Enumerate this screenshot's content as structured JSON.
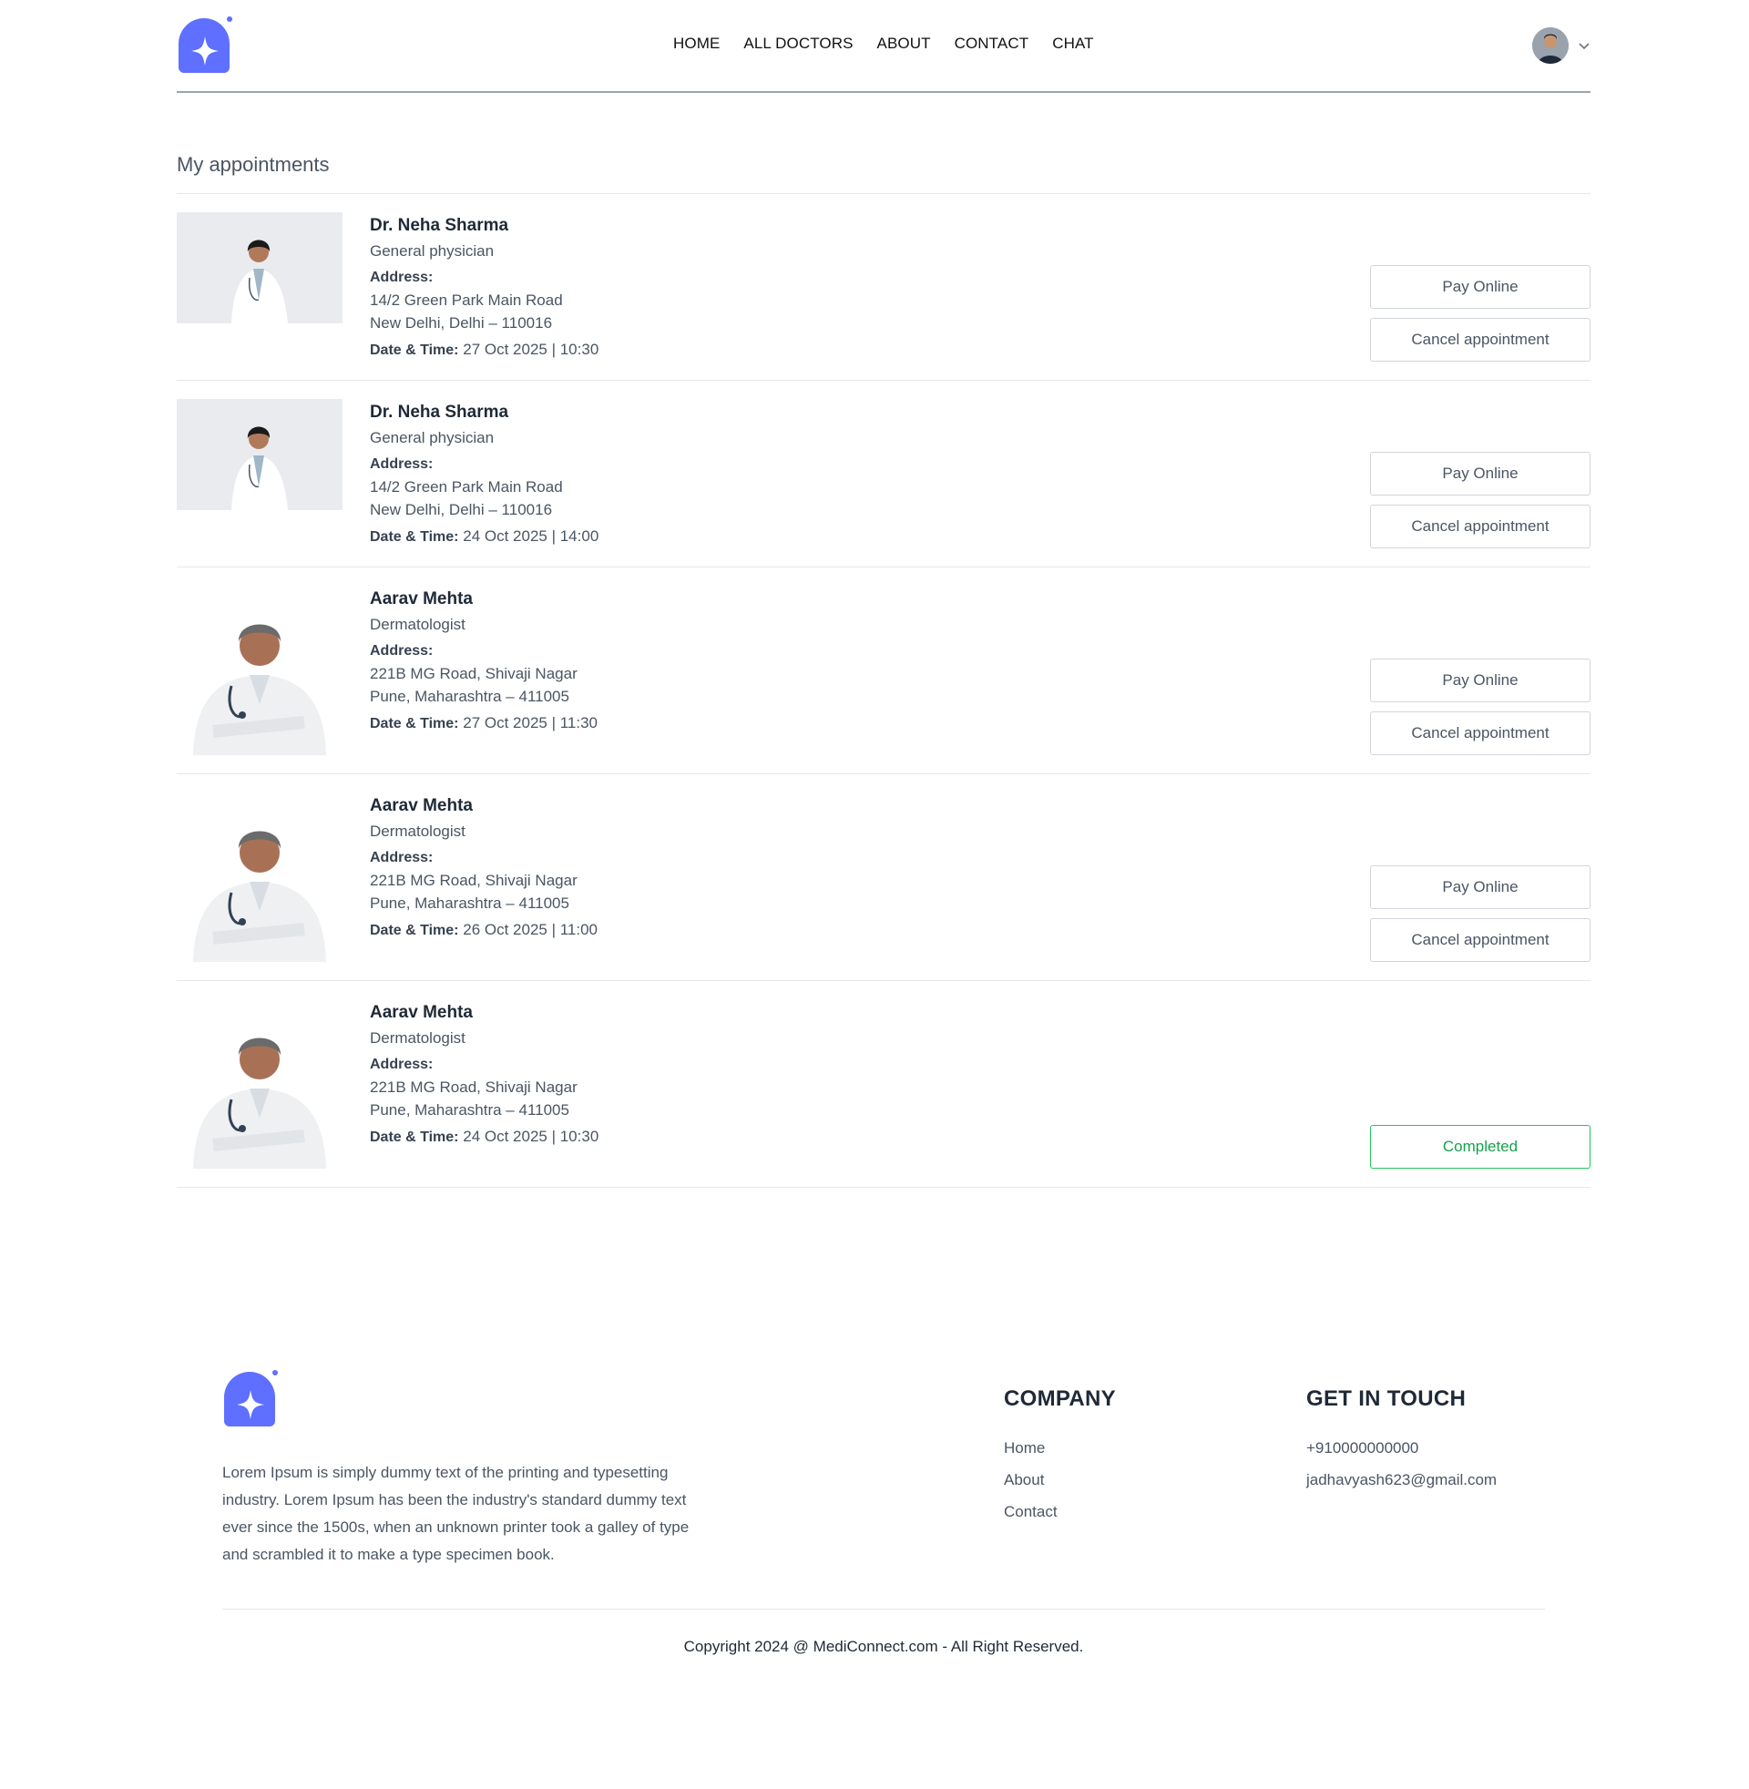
{
  "brand": {
    "accent": "#5f6fff"
  },
  "nav": {
    "items": [
      "HOME",
      "ALL DOCTORS",
      "ABOUT",
      "CONTACT",
      "CHAT"
    ]
  },
  "page": {
    "title": "My appointments"
  },
  "appointments": [
    {
      "name": "Dr. Neha Sharma",
      "speciality": "General physician",
      "address_label": "Address:",
      "address_line1": "14/2 Green Park Main Road",
      "address_line2": "New Delhi, Delhi – 110016",
      "datetime_label": "Date & Time:",
      "datetime": "27 Oct 2025 | 10:30",
      "pay_label": "Pay Online",
      "cancel_label": "Cancel appointment",
      "photo": "female-doctor"
    },
    {
      "name": "Dr. Neha Sharma",
      "speciality": "General physician",
      "address_label": "Address:",
      "address_line1": "14/2 Green Park Main Road",
      "address_line2": "New Delhi, Delhi – 110016",
      "datetime_label": "Date & Time:",
      "datetime": "24 Oct 2025 | 14:00",
      "pay_label": "Pay Online",
      "cancel_label": "Cancel appointment",
      "photo": "female-doctor"
    },
    {
      "name": "Aarav Mehta",
      "speciality": "Dermatologist",
      "address_label": "Address:",
      "address_line1": "221B MG Road, Shivaji Nagar",
      "address_line2": "Pune, Maharashtra – 411005",
      "datetime_label": "Date & Time:",
      "datetime": "27 Oct 2025 | 11:30",
      "pay_label": "Pay Online",
      "cancel_label": "Cancel appointment",
      "photo": "male-doctor"
    },
    {
      "name": "Aarav Mehta",
      "speciality": "Dermatologist",
      "address_label": "Address:",
      "address_line1": "221B MG Road, Shivaji Nagar",
      "address_line2": "Pune, Maharashtra – 411005",
      "datetime_label": "Date & Time:",
      "datetime": "26 Oct 2025 | 11:00",
      "pay_label": "Pay Online",
      "cancel_label": "Cancel appointment",
      "photo": "male-doctor"
    },
    {
      "name": "Aarav Mehta",
      "speciality": "Dermatologist",
      "address_label": "Address:",
      "address_line1": "221B MG Road, Shivaji Nagar",
      "address_line2": "Pune, Maharashtra – 411005",
      "datetime_label": "Date & Time:",
      "datetime": "24 Oct 2025 | 10:30",
      "status_label": "Completed",
      "photo": "male-doctor"
    }
  ],
  "footer": {
    "description": "Lorem Ipsum is simply dummy text of the printing and typesetting industry. Lorem Ipsum has been the industry's standard dummy text ever since the 1500s, when an unknown printer took a galley of type and scrambled it to make a type specimen book.",
    "company_heading": "COMPANY",
    "company_links": [
      "Home",
      "About",
      "Contact"
    ],
    "touch_heading": "GET IN TOUCH",
    "phone": "+910000000000",
    "email": "jadhavyash623@gmail.com",
    "copyright": "Copyright 2024 @ MediConnect.com - All Right Reserved."
  }
}
